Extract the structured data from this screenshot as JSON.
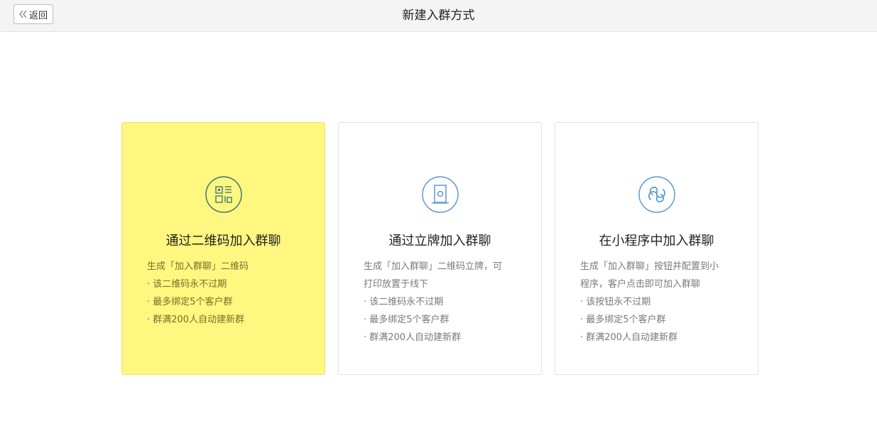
{
  "header": {
    "back_label": "返回",
    "title": "新建入群方式"
  },
  "colors": {
    "selected_card_bg": "#fff77f",
    "icon_stroke_selected": "#3e7a7e",
    "icon_stroke": "#5b9bd5"
  },
  "cards": [
    {
      "icon": "qr-code-icon",
      "title": "通过二维码加入群聊",
      "selected": true,
      "lines": [
        "生成「加入群聊」二维码",
        "· 该二维码永不过期",
        "· 最多绑定5个客户群",
        "· 群满200人自动建新群"
      ]
    },
    {
      "icon": "standee-icon",
      "title": "通过立牌加入群聊",
      "selected": false,
      "lines": [
        "生成「加入群聊」二维码立牌，可",
        "打印放置于线下",
        "· 该二维码永不过期",
        "· 最多绑定5个客户群",
        "· 群满200人自动建新群"
      ]
    },
    {
      "icon": "mini-program-icon",
      "title": "在小程序中加入群聊",
      "selected": false,
      "lines": [
        "生成「加入群聊」按钮并配置到小",
        "程序，客户点击即可加入群聊",
        "· 该按钮永不过期",
        "· 最多绑定5个客户群",
        "· 群满200人自动建新群"
      ]
    }
  ]
}
